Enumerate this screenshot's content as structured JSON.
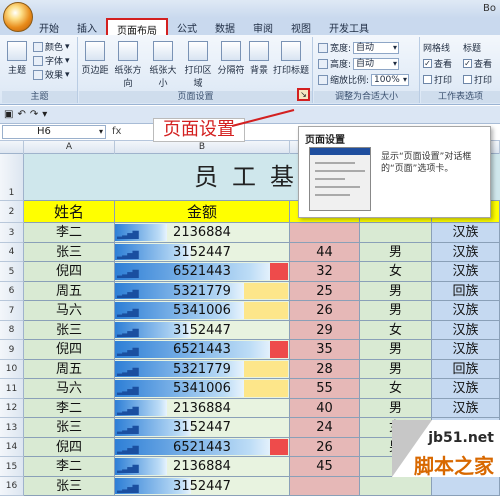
{
  "window": {
    "title": "Bo"
  },
  "tabs": [
    "开始",
    "插入",
    "页面布局",
    "公式",
    "数据",
    "审阅",
    "视图",
    "开发工具"
  ],
  "ribbon": {
    "theme_label": "主题",
    "colors_label": "颜色",
    "fonts_label": "字体",
    "effects_label": "效果",
    "group_theme": "主题",
    "page_buttons": [
      "页边距",
      "纸张方向",
      "纸张大小",
      "打印区域",
      "分隔符",
      "背景",
      "打印标题"
    ],
    "group_page_setup": "页面设置",
    "width_label": "宽度:",
    "width_value": "自动",
    "height_label": "高度:",
    "height_value": "自动",
    "scale_label": "缩放比例:",
    "scale_value": "100%",
    "group_scale": "调整为合适大小",
    "gridlines_label": "网格线",
    "headings_label": "标题",
    "view_label": "查看",
    "print_label": "打印",
    "group_sheet_options": "工作表选项",
    "launcher_icon": "dialog-launcher-icon"
  },
  "formula_bar": {
    "name_box": "H6",
    "fx": "fx"
  },
  "annotation": "页面设置",
  "popup": {
    "title": "页面设置",
    "description": "显示“页面设置”对话框的“页面”选项卡。"
  },
  "sheet": {
    "columns": [
      "A",
      "B",
      "C"
    ],
    "title": "员工基本",
    "headers": {
      "name": "姓名",
      "amount": "金额"
    },
    "rows": [
      {
        "num": "3",
        "name": "李二",
        "amount": "2136884",
        "c": "",
        "d": "",
        "e": "汉族",
        "amount_fraction": 0.33
      },
      {
        "num": "4",
        "name": "张三",
        "amount": "3152447",
        "c": "44",
        "d": "男",
        "e": "汉族",
        "amount_fraction": 0.48
      },
      {
        "num": "5",
        "name": "倪四",
        "amount": "6521443",
        "c": "32",
        "d": "女",
        "e": "汉族",
        "amount_fraction": 1.0
      },
      {
        "num": "6",
        "name": "周五",
        "amount": "5321779",
        "c": "25",
        "d": "男",
        "e": "回族",
        "amount_fraction": 0.82
      },
      {
        "num": "7",
        "name": "马六",
        "amount": "5341006",
        "c": "26",
        "d": "男",
        "e": "汉族",
        "amount_fraction": 0.82
      },
      {
        "num": "8",
        "name": "张三",
        "amount": "3152447",
        "c": "29",
        "d": "女",
        "e": "汉族",
        "amount_fraction": 0.48
      },
      {
        "num": "9",
        "name": "倪四",
        "amount": "6521443",
        "c": "35",
        "d": "男",
        "e": "汉族",
        "amount_fraction": 1.0
      },
      {
        "num": "10",
        "name": "周五",
        "amount": "5321779",
        "c": "28",
        "d": "男",
        "e": "回族",
        "amount_fraction": 0.82
      },
      {
        "num": "11",
        "name": "马六",
        "amount": "5341006",
        "c": "55",
        "d": "女",
        "e": "汉族",
        "amount_fraction": 0.82
      },
      {
        "num": "12",
        "name": "李二",
        "amount": "2136884",
        "c": "40",
        "d": "男",
        "e": "汉族",
        "amount_fraction": 0.33
      },
      {
        "num": "13",
        "name": "张三",
        "amount": "3152447",
        "c": "24",
        "d": "女",
        "e": "汉族",
        "amount_fraction": 0.48
      },
      {
        "num": "14",
        "name": "倪四",
        "amount": "6521443",
        "c": "26",
        "d": "男",
        "e": "",
        "amount_fraction": 1.0
      },
      {
        "num": "15",
        "name": "李二",
        "amount": "2136884",
        "c": "45",
        "d": "",
        "e": "",
        "amount_fraction": 0.33
      },
      {
        "num": "16",
        "name": "张三",
        "amount": "3152447",
        "c": "",
        "d": "",
        "e": "",
        "amount_fraction": 0.48
      }
    ],
    "colors": {
      "name_cell": "#d9ead3",
      "bar": "#2e7fd6",
      "col_c": "#e6b8b7",
      "col_d": "#d9ead3",
      "col_e": "#c5d9f1",
      "header": "#ffff00",
      "title_bg": "#cfe7ec"
    }
  },
  "watermark": {
    "site": "jb51.net",
    "name": "脚本之家"
  }
}
